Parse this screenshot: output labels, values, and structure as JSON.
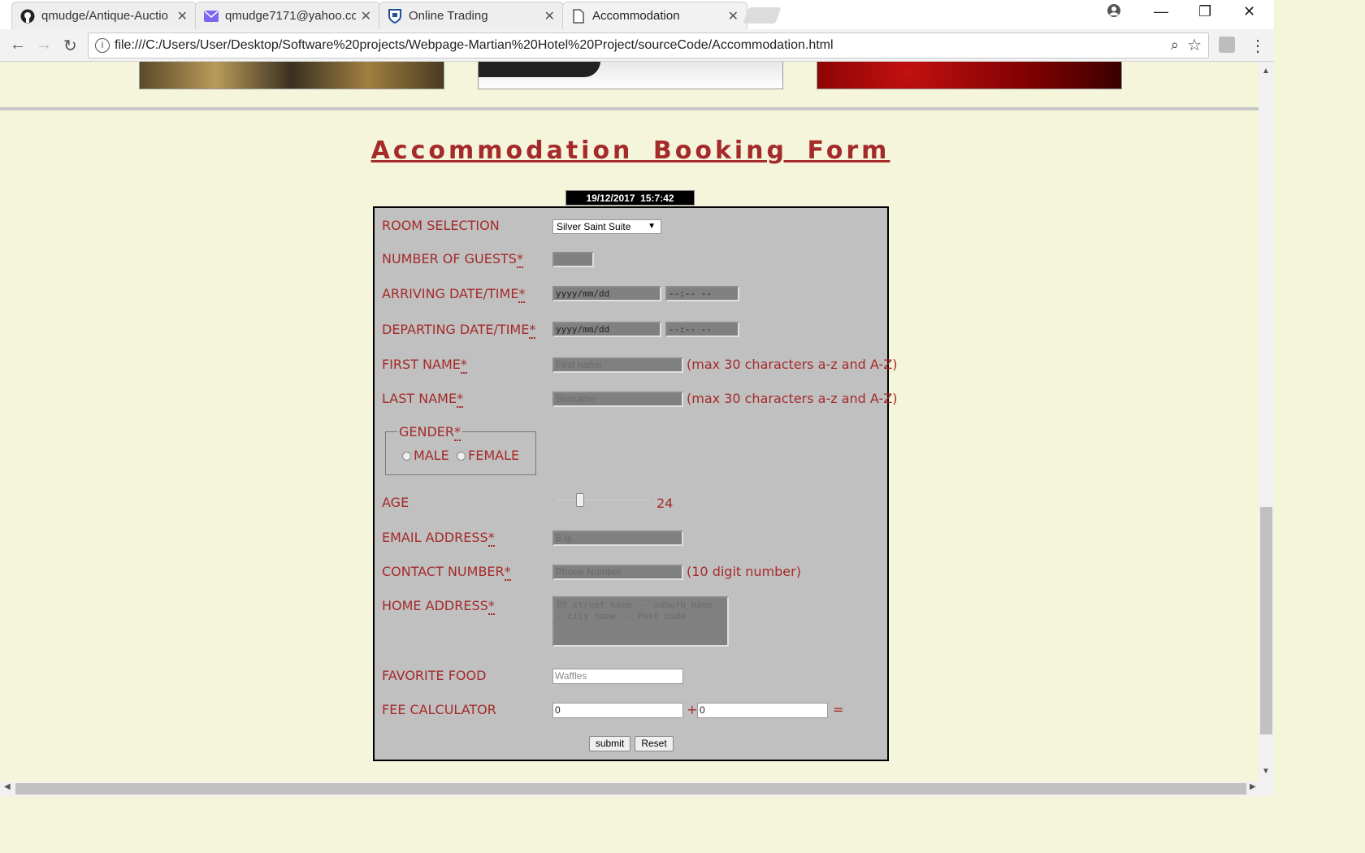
{
  "browser": {
    "tabs": [
      {
        "title": "qmudge/Antique-Auctio",
        "icon": "github-icon"
      },
      {
        "title": "qmudge7171@yahoo.co",
        "icon": "mail-icon"
      },
      {
        "title": "Online Trading",
        "icon": "bank-shield-icon"
      },
      {
        "title": "Accommodation",
        "icon": "page-icon"
      }
    ],
    "url": "file:///C:/Users/User/Desktop/Software%20projects/Webpage-Martian%20Hotel%20Project/sourceCode/Accommodation.html"
  },
  "page": {
    "heading": "Accommodation Booking Form",
    "clock": "19/12/2017  15:7:42"
  },
  "form": {
    "room_label": "ROOM SELECTION",
    "room_value": "Silver Saint Suite",
    "guests_label": "NUMBER OF GUESTS",
    "arriving_label": "ARRIVING DATE/TIME",
    "departing_label": "DEPARTING DATE/TIME",
    "date_placeholder": "yyyy/mm/dd",
    "time_placeholder": "--:-- --",
    "required_mark": "*",
    "first_name_label": "FIRST NAME",
    "first_name_placeholder": "First name",
    "name_hint": "(max 30 characters a-z and A-Z)",
    "last_name_label": "LAST NAME",
    "last_name_placeholder": "Surname",
    "gender_legend": "GENDER",
    "gender_male": "MALE",
    "gender_female": "FEMALE",
    "age_label": "AGE",
    "age_value": "24",
    "email_label": "EMAIL ADDRESS",
    "email_placeholder": "E.g.",
    "contact_label": "CONTACT NUMBER",
    "contact_placeholder": "Phone Number",
    "contact_hint": "(10 digit number)",
    "home_label": "HOME ADDRESS",
    "home_placeholder": "09 street name -- suburb name -- city name -- Post code",
    "food_label": "FAVORITE FOOD",
    "food_placeholder": "Waffles",
    "fee_label": "FEE CALCULATOR",
    "fee_a": "0",
    "fee_b": "0",
    "plus": "+",
    "equals": "=",
    "submit_label": "submit",
    "reset_label": "Reset"
  },
  "colors": {
    "label": "#a52a2a",
    "form_bg": "#c0c0c0",
    "page_bg": "#f5f5dc"
  }
}
